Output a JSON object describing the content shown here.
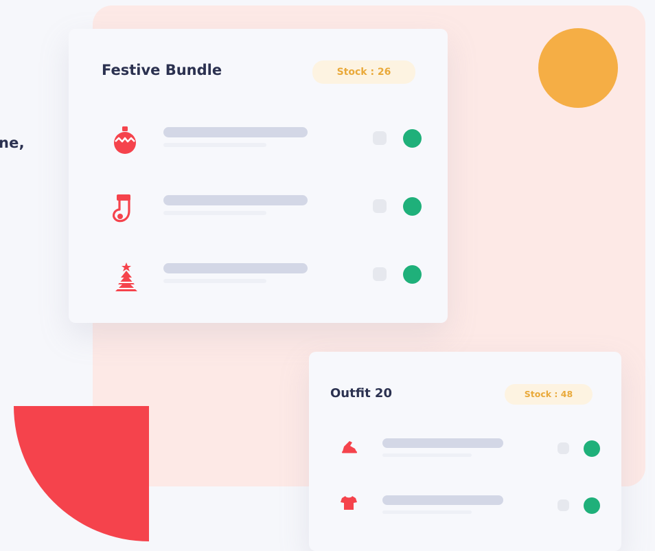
{
  "side_text": "ne,",
  "colors": {
    "accent_red": "#f5434c",
    "accent_orange": "#f5ae45",
    "status_green": "#1fb07a",
    "title_navy": "#2b3150",
    "badge_text": "#e9a93a"
  },
  "cards": {
    "festive": {
      "title": "Festive Bundle",
      "stock": "Stock : 26",
      "items": [
        {
          "icon": "ornament-icon",
          "status": "available"
        },
        {
          "icon": "stocking-icon",
          "status": "available"
        },
        {
          "icon": "christmas-tree-icon",
          "status": "available"
        }
      ]
    },
    "outfit": {
      "title": "Outfit 20",
      "stock": "Stock : 48",
      "items": [
        {
          "icon": "sneaker-icon",
          "status": "available"
        },
        {
          "icon": "tshirt-icon",
          "status": "available"
        }
      ]
    }
  }
}
